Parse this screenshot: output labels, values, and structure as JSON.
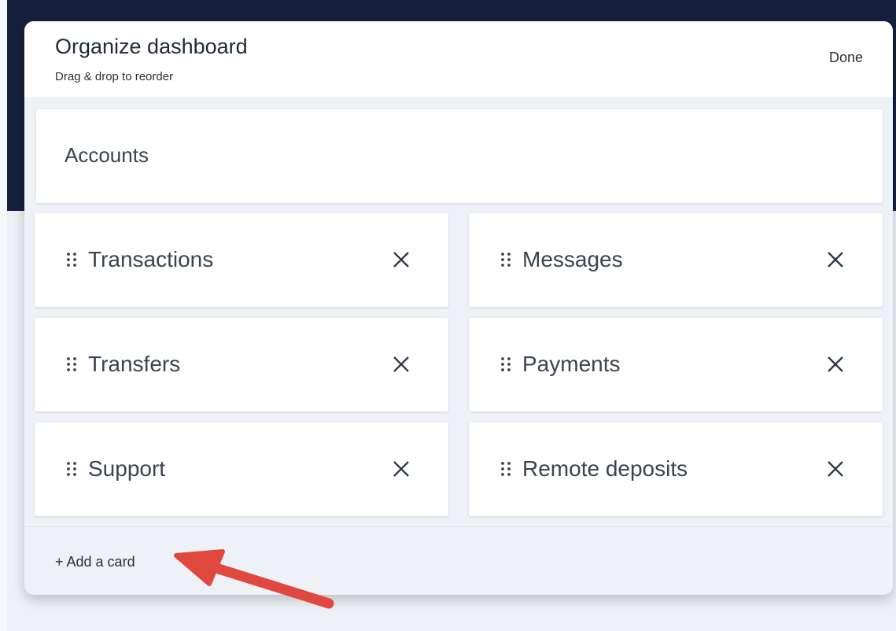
{
  "modal": {
    "title": "Organize dashboard",
    "subtitle": "Drag & drop to reorder",
    "done_label": "Done"
  },
  "fixed_card": {
    "label": "Accounts"
  },
  "cards": [
    {
      "label": "Transactions"
    },
    {
      "label": "Messages"
    },
    {
      "label": "Transfers"
    },
    {
      "label": "Payments"
    },
    {
      "label": "Support"
    },
    {
      "label": "Remote deposits"
    }
  ],
  "footer": {
    "add_card_label": "+ Add a card"
  },
  "icons": {
    "drag": "drag-handle-icon",
    "remove": "close-icon"
  },
  "colors": {
    "backdrop": "#16203c",
    "modal_background": "#eef1f6",
    "card_background": "#ffffff",
    "text": "#3a4350",
    "annotation_arrow": "#e0483f"
  }
}
